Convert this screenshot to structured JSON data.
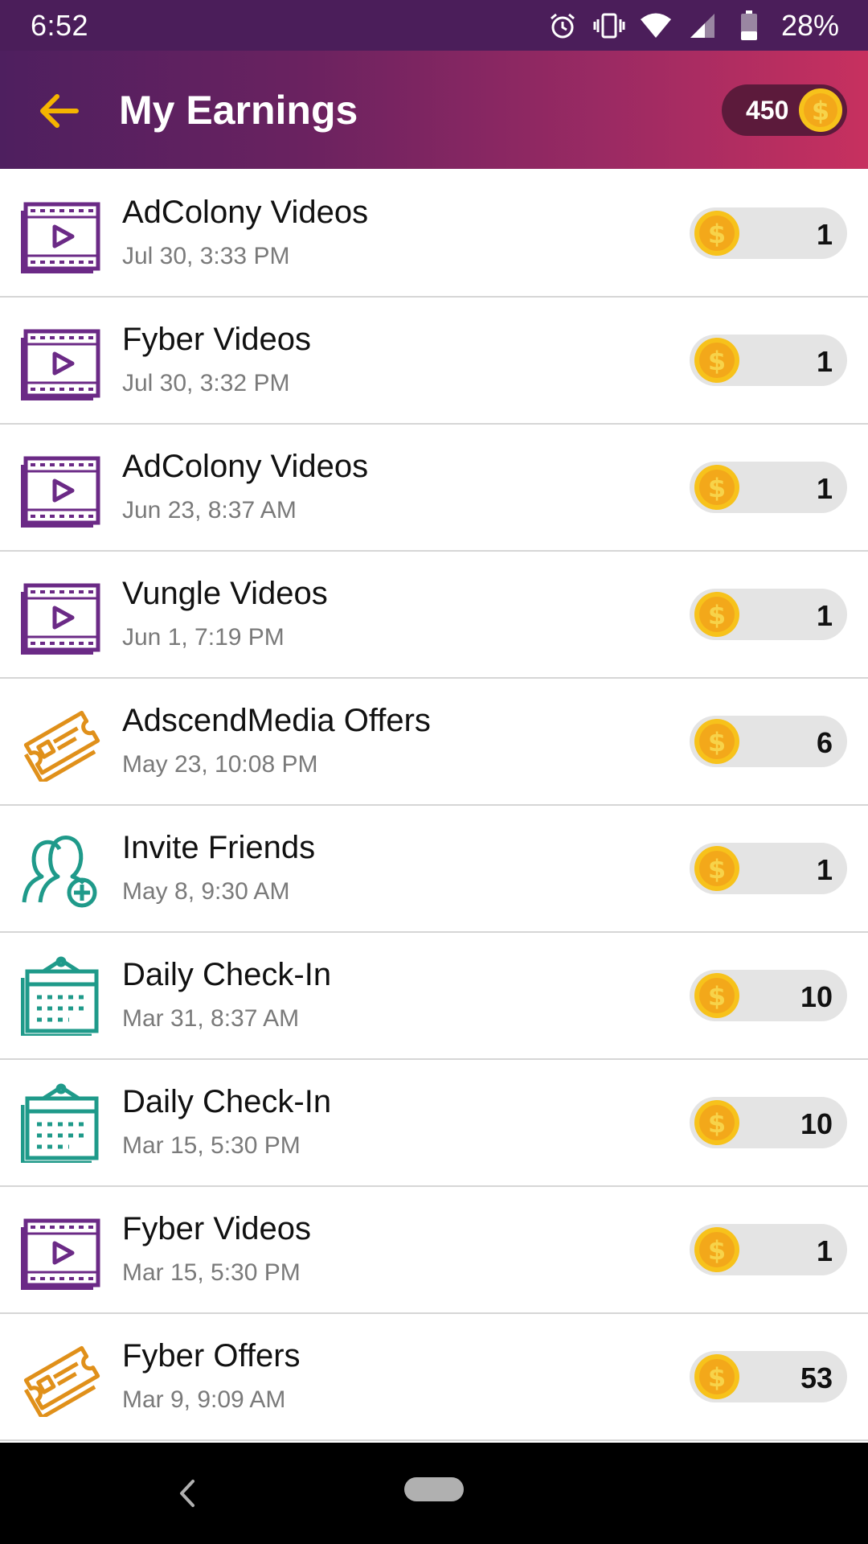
{
  "status_bar": {
    "time": "6:52",
    "battery": "28%",
    "icons": [
      "alarm-icon",
      "vibrate-icon",
      "wifi-icon",
      "signal-icon",
      "battery-icon"
    ]
  },
  "header": {
    "title": "My Earnings",
    "balance": "450",
    "back_icon": "arrow-left-icon",
    "gradient_start": "#4e1f5f",
    "gradient_end": "#c7305f",
    "accent": "#f5b400"
  },
  "earnings": [
    {
      "title": "AdColony Videos",
      "date": "Jul 30, 3:33 PM",
      "points": "1",
      "icon": "video-icon"
    },
    {
      "title": "Fyber Videos",
      "date": "Jul 30, 3:32 PM",
      "points": "1",
      "icon": "video-icon"
    },
    {
      "title": "AdColony Videos",
      "date": "Jun 23, 8:37 AM",
      "points": "1",
      "icon": "video-icon"
    },
    {
      "title": "Vungle Videos",
      "date": "Jun 1, 7:19 PM",
      "points": "1",
      "icon": "video-icon"
    },
    {
      "title": "AdscendMedia Offers",
      "date": "May 23, 10:08 PM",
      "points": "6",
      "icon": "ticket-icon"
    },
    {
      "title": "Invite  Friends",
      "date": "May 8, 9:30 AM",
      "points": "1",
      "icon": "add-friend-icon"
    },
    {
      "title": "Daily Check-In",
      "date": "Mar 31, 8:37 AM",
      "points": "10",
      "icon": "calendar-icon"
    },
    {
      "title": "Daily Check-In",
      "date": "Mar 15, 5:30 PM",
      "points": "10",
      "icon": "calendar-icon"
    },
    {
      "title": "Fyber Videos",
      "date": "Mar 15, 5:30 PM",
      "points": "1",
      "icon": "video-icon"
    },
    {
      "title": "Fyber Offers",
      "date": "Mar 9, 9:09 AM",
      "points": "53",
      "icon": "ticket-icon"
    }
  ],
  "colors": {
    "video": "#6b2a86",
    "ticket": "#e0901a",
    "teal": "#1f9a8a",
    "coin": "#f7c21b"
  },
  "nav": {
    "back_icon": "nav-back-icon",
    "home_icon": "nav-home-pill"
  }
}
